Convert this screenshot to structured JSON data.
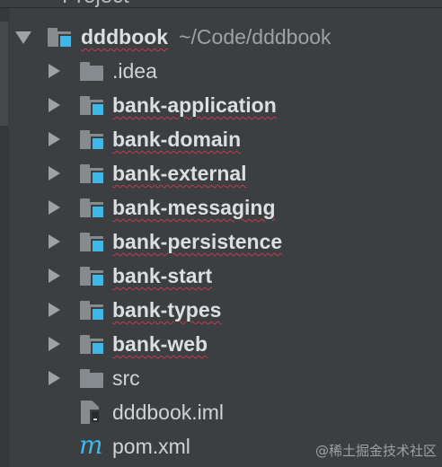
{
  "panel": {
    "title": "Project",
    "title_chevron_icon": "chevron-down-icon"
  },
  "tree": {
    "root": {
      "name": "dddbook",
      "path": "~/Code/dddbook",
      "expanded": true,
      "icon": "module-folder-icon"
    },
    "items": [
      {
        "name": ".idea",
        "kind": "folder",
        "bold": false,
        "icon": "folder-icon"
      },
      {
        "name": "bank-application",
        "kind": "module",
        "bold": true,
        "icon": "module-folder-icon"
      },
      {
        "name": "bank-domain",
        "kind": "module",
        "bold": true,
        "icon": "module-folder-icon"
      },
      {
        "name": "bank-external",
        "kind": "module",
        "bold": true,
        "icon": "module-folder-icon"
      },
      {
        "name": "bank-messaging",
        "kind": "module",
        "bold": true,
        "icon": "module-folder-icon"
      },
      {
        "name": "bank-persistence",
        "kind": "module",
        "bold": true,
        "icon": "module-folder-icon"
      },
      {
        "name": "bank-start",
        "kind": "module",
        "bold": true,
        "icon": "module-folder-icon"
      },
      {
        "name": "bank-types",
        "kind": "module",
        "bold": true,
        "icon": "module-folder-icon"
      },
      {
        "name": "bank-web",
        "kind": "module",
        "bold": true,
        "icon": "module-folder-icon"
      },
      {
        "name": "src",
        "kind": "folder",
        "bold": false,
        "icon": "folder-icon"
      },
      {
        "name": "dddbook.iml",
        "kind": "file",
        "bold": false,
        "icon": "iml-file-icon"
      },
      {
        "name": "pom.xml",
        "kind": "file",
        "bold": false,
        "icon": "maven-file-icon",
        "glyph": "m"
      }
    ]
  },
  "watermark": "@稀土掘金技术社区",
  "colors": {
    "background": "#3b3f41",
    "text": "#d1d3d4",
    "path_text": "#9ea2a5",
    "folder": "#868b8f",
    "module_badge": "#3fb8e8",
    "spellcheck_underline": "#c9374b"
  }
}
